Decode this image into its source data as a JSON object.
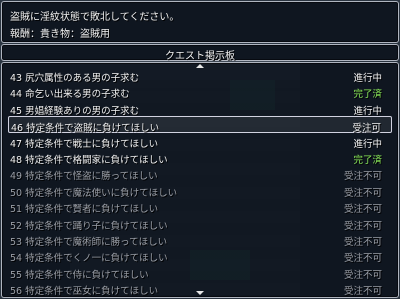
{
  "description": {
    "line1": "盗賊に淫紋状態で敗北してください。",
    "line2": "報酬：貴き物：盗賊用"
  },
  "header": {
    "title": "クエスト掲示板"
  },
  "colors": {
    "active": "#f2f2f2",
    "in_progress": "#8ef05a",
    "complete": "#8ef05a",
    "disabled": "#9a9ea6"
  },
  "quests": [
    {
      "no": "43",
      "title": "尻穴属性のある男の子求む",
      "status": "進行中",
      "state": "active"
    },
    {
      "no": "44",
      "title": "命乞い出来る男の子求む",
      "status": "完了済",
      "state": "active"
    },
    {
      "no": "45",
      "title": "男娼経験ありの男の子求む",
      "status": "進行中",
      "state": "active"
    },
    {
      "no": "46",
      "title": "特定条件で盗賊に負けてほしい",
      "status": "受注可",
      "state": "active"
    },
    {
      "no": "47",
      "title": "特定条件で戦士に負けてほしい",
      "status": "進行中",
      "state": "active"
    },
    {
      "no": "48",
      "title": "特定条件で格闘家に負けてほしい",
      "status": "完了済",
      "state": "active"
    },
    {
      "no": "49",
      "title": "特定条件で怪盗に勝ってほしい",
      "status": "受注不可",
      "state": "disabled"
    },
    {
      "no": "50",
      "title": "特定条件で魔法使いに負けてほしい",
      "status": "受注不可",
      "state": "disabled"
    },
    {
      "no": "51",
      "title": "特定条件で賢者に負けてほしい",
      "status": "受注不可",
      "state": "disabled"
    },
    {
      "no": "52",
      "title": "特定条件で踊り子に負けてほしい",
      "status": "受注不可",
      "state": "disabled"
    },
    {
      "no": "53",
      "title": "特定条件で魔術師に勝ってほしい",
      "status": "受注不可",
      "state": "disabled"
    },
    {
      "no": "54",
      "title": "特定条件でくノ一に負けてほしい",
      "status": "受注不可",
      "state": "disabled"
    },
    {
      "no": "55",
      "title": "特定条件で侍に負けてほしい",
      "status": "受注不可",
      "state": "disabled"
    },
    {
      "no": "56",
      "title": "特定条件で巫女に負けてほしい",
      "status": "受注不可",
      "state": "disabled"
    }
  ],
  "selected_index": 3
}
